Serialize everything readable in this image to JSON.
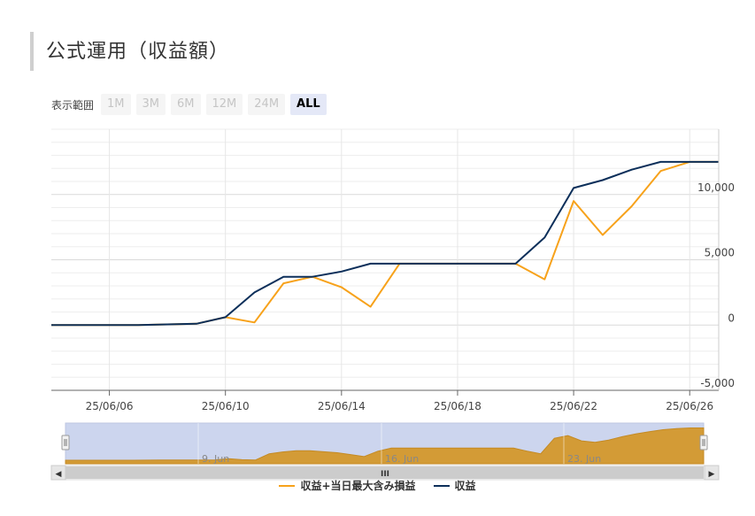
{
  "page_title": "公式運用（収益額）",
  "range_selector": {
    "label": "表示範囲",
    "buttons": [
      {
        "label": "1M",
        "active": false
      },
      {
        "label": "3M",
        "active": false
      },
      {
        "label": "6M",
        "active": false
      },
      {
        "label": "12M",
        "active": false
      },
      {
        "label": "24M",
        "active": false
      },
      {
        "label": "ALL",
        "active": true
      }
    ]
  },
  "colors": {
    "series_orange": "#f7a21b",
    "series_navy": "#0c2f5a",
    "navigator_fill": "#d39b36",
    "navigator_mask": "#ccd5ee",
    "gridline": "#e6e6e6"
  },
  "chart_data": {
    "type": "line",
    "x": [
      "25/06/04",
      "25/06/05",
      "25/06/06",
      "25/06/07",
      "25/06/08",
      "25/06/09",
      "25/06/10",
      "25/06/11",
      "25/06/12",
      "25/06/13",
      "25/06/14",
      "25/06/15",
      "25/06/16",
      "25/06/17",
      "25/06/18",
      "25/06/19",
      "25/06/20",
      "25/06/21",
      "25/06/22",
      "25/06/23",
      "25/06/24",
      "25/06/25",
      "25/06/26",
      "25/06/27"
    ],
    "series": [
      {
        "name": "収益+当日最大含み損益",
        "color": "#f7a21b",
        "values": [
          0,
          0,
          0,
          0,
          50,
          100,
          600,
          200,
          3200,
          3700,
          2900,
          1400,
          4700,
          4700,
          4700,
          4700,
          4700,
          3500,
          9500,
          6900,
          9100,
          11800,
          12500,
          12500
        ]
      },
      {
        "name": "収益",
        "color": "#0c2f5a",
        "values": [
          0,
          0,
          0,
          0,
          50,
          100,
          600,
          2500,
          3700,
          3700,
          4100,
          4700,
          4700,
          4700,
          4700,
          4700,
          4700,
          6700,
          10500,
          11100,
          11900,
          12500,
          12500,
          12500
        ]
      }
    ],
    "y_ticks": [
      "-5,000",
      "0",
      "5,000",
      "10,000"
    ],
    "y_tick_values": [
      -5000,
      0,
      5000,
      10000
    ],
    "x_ticks": [
      "25/06/06",
      "25/06/10",
      "25/06/14",
      "25/06/18",
      "25/06/22",
      "25/06/26"
    ],
    "ylim": [
      -5000,
      15000
    ],
    "grid": true,
    "legend_position": "bottom-center",
    "navigator": {
      "labels": [
        "9. Jun",
        "16. Jun",
        "23. Jun"
      ],
      "handle_glyph": "III",
      "left_arrow": "◀",
      "right_arrow": "▶",
      "values": [
        0,
        0,
        0,
        0,
        0,
        0,
        50,
        100,
        100,
        100,
        100,
        150,
        600,
        200,
        100,
        2500,
        3200,
        3700,
        3700,
        3300,
        2900,
        2200,
        1400,
        3500,
        4700,
        4700,
        4700,
        4700,
        4700,
        4700,
        4700,
        4700,
        4700,
        4700,
        3500,
        2500,
        8500,
        9500,
        7500,
        6900,
        7800,
        9100,
        10200,
        11000,
        11800,
        12200,
        12500,
        12500
      ]
    }
  }
}
